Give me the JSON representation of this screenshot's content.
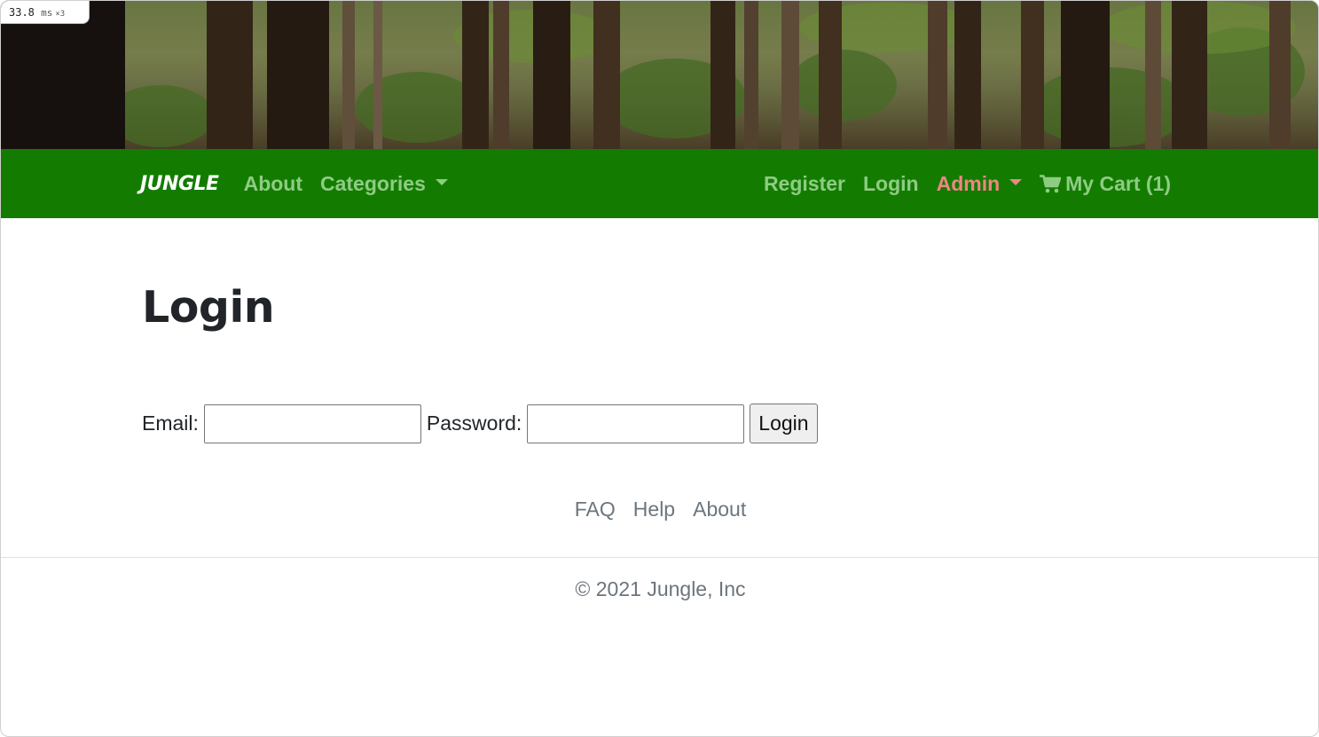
{
  "perf_badge": {
    "value": "33.8",
    "unit": "ms",
    "multiplier": "×3"
  },
  "navbar": {
    "brand": "JUNGLE",
    "about": "About",
    "categories": "Categories",
    "register": "Register",
    "login": "Login",
    "admin": "Admin",
    "cart": "My Cart (1)"
  },
  "page": {
    "title": "Login"
  },
  "form": {
    "email_label": "Email:",
    "email_value": "",
    "password_label": "Password:",
    "password_value": "",
    "submit_label": "Login"
  },
  "footer": {
    "links": [
      "FAQ",
      "Help",
      "About"
    ],
    "copyright": "© 2021 Jungle, Inc"
  },
  "colors": {
    "navbar_bg": "#137c00",
    "nav_link": "#8fcc83",
    "admin_link": "#f08585",
    "footer_text": "#6c757d"
  }
}
